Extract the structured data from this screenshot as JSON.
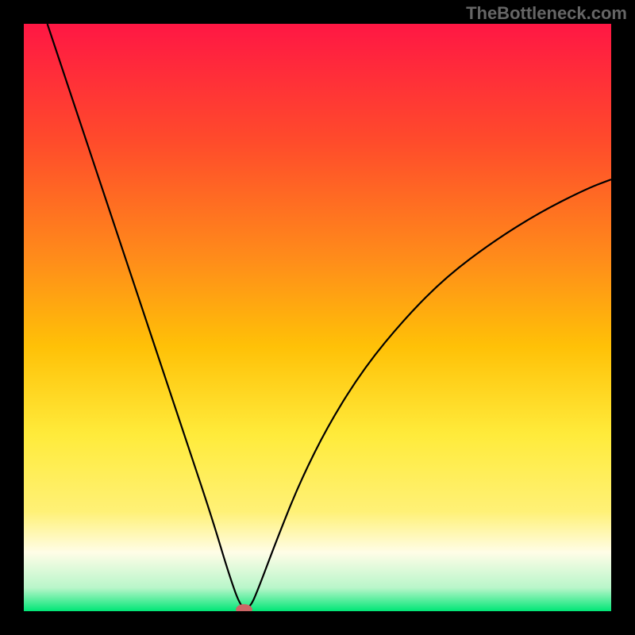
{
  "watermark": "TheBottleneck.com",
  "chart_data": {
    "type": "line",
    "title": "",
    "xlabel": "",
    "ylabel": "",
    "xlim": [
      0,
      100
    ],
    "ylim": [
      0,
      100
    ],
    "background": {
      "type": "vertical-gradient",
      "stops": [
        {
          "pos": 0.0,
          "color": "#ff1744"
        },
        {
          "pos": 0.2,
          "color": "#ff4b2b"
        },
        {
          "pos": 0.4,
          "color": "#ff8c1a"
        },
        {
          "pos": 0.55,
          "color": "#ffc107"
        },
        {
          "pos": 0.7,
          "color": "#ffeb3b"
        },
        {
          "pos": 0.83,
          "color": "#fff176"
        },
        {
          "pos": 0.9,
          "color": "#fffde7"
        },
        {
          "pos": 0.96,
          "color": "#b9f6ca"
        },
        {
          "pos": 1.0,
          "color": "#00e676"
        }
      ]
    },
    "series": [
      {
        "name": "bottleneck-curve",
        "color": "#000000",
        "points": [
          {
            "x": 4.0,
            "y": 100.0
          },
          {
            "x": 8.0,
            "y": 88.0
          },
          {
            "x": 12.0,
            "y": 76.0
          },
          {
            "x": 16.0,
            "y": 64.0
          },
          {
            "x": 20.0,
            "y": 52.0
          },
          {
            "x": 24.0,
            "y": 40.0
          },
          {
            "x": 28.0,
            "y": 28.0
          },
          {
            "x": 32.0,
            "y": 16.0
          },
          {
            "x": 35.0,
            "y": 6.0
          },
          {
            "x": 37.0,
            "y": 0.5
          },
          {
            "x": 38.5,
            "y": 0.5
          },
          {
            "x": 40.0,
            "y": 4.0
          },
          {
            "x": 43.0,
            "y": 12.0
          },
          {
            "x": 47.0,
            "y": 22.0
          },
          {
            "x": 52.0,
            "y": 32.0
          },
          {
            "x": 58.0,
            "y": 41.5
          },
          {
            "x": 65.0,
            "y": 50.0
          },
          {
            "x": 72.0,
            "y": 57.0
          },
          {
            "x": 80.0,
            "y": 63.0
          },
          {
            "x": 88.0,
            "y": 68.0
          },
          {
            "x": 96.0,
            "y": 72.0
          },
          {
            "x": 100.0,
            "y": 73.5
          }
        ]
      }
    ],
    "marker": {
      "name": "optimal-point",
      "x": 37.5,
      "y": 0.3,
      "rx": 1.4,
      "ry": 0.9,
      "color": "#cc6666"
    }
  }
}
